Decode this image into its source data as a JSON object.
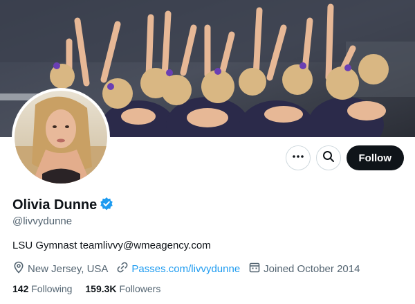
{
  "profile": {
    "name": "Olivia Dunne",
    "handle": "@livvydunne",
    "bio": "LSU Gymnast teamlivvy@wmeagency.com",
    "location": "New Jersey, USA",
    "website": "Passes.com/livvydunne",
    "joined": "Joined October 2014"
  },
  "stats": {
    "following_count": "142",
    "following_label": "Following",
    "followers_count": "159.3K",
    "followers_label": "Followers"
  },
  "actions": {
    "follow_label": "Follow"
  },
  "icons": {
    "more": "more-icon",
    "search": "search-icon",
    "verified": "verified-badge-icon",
    "location": "location-pin-icon",
    "link": "link-icon",
    "calendar": "calendar-icon"
  },
  "colors": {
    "accent": "#1d9bf0",
    "text": "#0f1419",
    "secondary": "#536471",
    "follow_bg": "#0f1419"
  }
}
